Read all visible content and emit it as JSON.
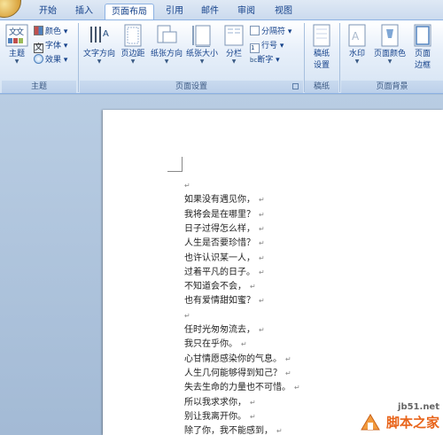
{
  "tabs": [
    {
      "label": "开始",
      "active": false
    },
    {
      "label": "插入",
      "active": false
    },
    {
      "label": "页面布局",
      "active": true
    },
    {
      "label": "引用",
      "active": false
    },
    {
      "label": "邮件",
      "active": false
    },
    {
      "label": "审阅",
      "active": false
    },
    {
      "label": "视图",
      "active": false
    }
  ],
  "ribbon": {
    "themes": {
      "group_label": "主题",
      "themes_button": "主题",
      "colors": "颜色",
      "fonts": "字体",
      "effects": "效果"
    },
    "page_setup": {
      "group_label": "页面设置",
      "text_direction": "文字方向",
      "margins": "页边距",
      "orientation": "纸张方向",
      "size": "纸张大小",
      "columns": "分栏",
      "breaks": "分隔符",
      "line_numbers": "行号",
      "hyphenation": "断字",
      "hyphenation_prefix": "bc"
    },
    "draft_paper": {
      "group_label": "稿纸",
      "button_line1": "稿纸",
      "button_line2": "设置"
    },
    "page_background": {
      "group_label": "页面背景",
      "watermark": "水印",
      "page_color": "页面颜色",
      "page_borders_line1": "页面",
      "page_borders_line2": "边框"
    }
  },
  "document": {
    "lines": [
      "",
      "如果没有遇见你，",
      "我将会是在哪里？",
      "日子过得怎么样，",
      "人生是否要珍惜？",
      "也许认识某一人，",
      "过着平凡的日子。",
      "不知道会不会，",
      "也有爱情甜如蜜？",
      "",
      "任时光匆匆流去，",
      "我只在乎你。",
      "心甘情愿感染你的气息。",
      "人生几何能够得到知己？",
      "失去生命的力量也不可惜。",
      "所以我求求你，",
      "别让我离开你。",
      "除了你，我不能感到，"
    ],
    "paragraph_mark": "↵"
  },
  "watermark": {
    "site": "jb51.net",
    "name": "脚本之家"
  },
  "colors": {
    "accent": "#15428b",
    "watermark_orange": "#e8641a"
  }
}
